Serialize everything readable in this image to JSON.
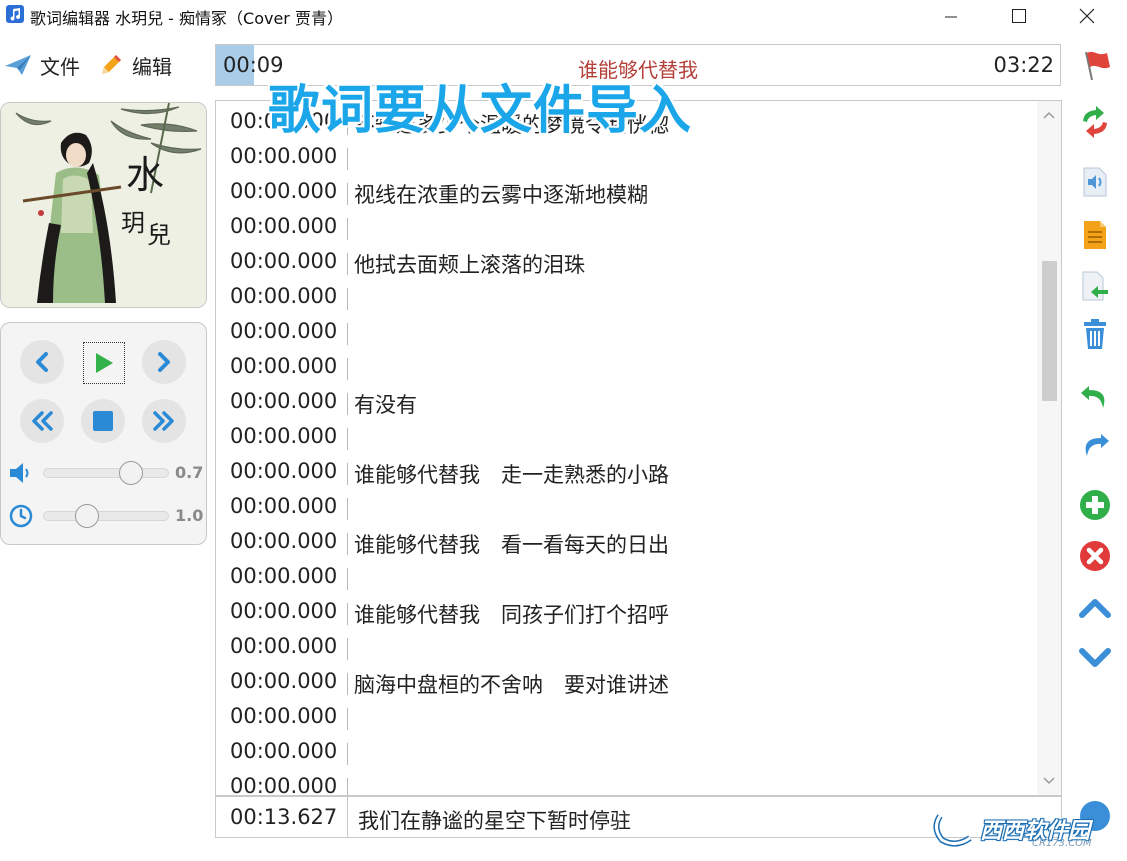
{
  "window": {
    "title": "歌词编辑器 水玥兒 - 痴情冢（Cover 贾青）",
    "minimize_icon": "minimize-icon",
    "maximize_icon": "maximize-icon",
    "close_icon": "close-icon"
  },
  "menu": {
    "file_label": "文件",
    "edit_label": "编辑"
  },
  "progress": {
    "current_time": "00:09",
    "song_title": "谁能够代替我",
    "total_time": "03:22",
    "fraction": 0.045
  },
  "overlay_caption": "歌词要从文件导入",
  "album": {
    "artist_text": "水玥兒"
  },
  "player": {
    "volume_value": "0.7",
    "volume_fraction": 0.7,
    "speed_value": "1.0",
    "speed_fraction": 0.35
  },
  "lyrics": [
    {
      "time": "00:00.000",
      "text": "不知道多少个温暖的梦境令我恍惚"
    },
    {
      "time": "00:00.000",
      "text": ""
    },
    {
      "time": "00:00.000",
      "text": "视线在浓重的云雾中逐渐地模糊"
    },
    {
      "time": "00:00.000",
      "text": ""
    },
    {
      "time": "00:00.000",
      "text": "他拭去面颊上滚落的泪珠"
    },
    {
      "time": "00:00.000",
      "text": ""
    },
    {
      "time": "00:00.000",
      "text": ""
    },
    {
      "time": "00:00.000",
      "text": ""
    },
    {
      "time": "00:00.000",
      "text": "有没有"
    },
    {
      "time": "00:00.000",
      "text": ""
    },
    {
      "time": "00:00.000",
      "text": "谁能够代替我　走一走熟悉的小路"
    },
    {
      "time": "00:00.000",
      "text": ""
    },
    {
      "time": "00:00.000",
      "text": "谁能够代替我　看一看每天的日出"
    },
    {
      "time": "00:00.000",
      "text": ""
    },
    {
      "time": "00:00.000",
      "text": "谁能够代替我　同孩子们打个招呼"
    },
    {
      "time": "00:00.000",
      "text": ""
    },
    {
      "time": "00:00.000",
      "text": "脑海中盘桓的不舍呐　要对谁讲述"
    },
    {
      "time": "00:00.000",
      "text": ""
    },
    {
      "time": "00:00.000",
      "text": ""
    },
    {
      "time": "00:00.000",
      "text": ""
    }
  ],
  "edit": {
    "time": "00:13.627",
    "lyric": "我们在静谧的星空下暂时停驻"
  },
  "toolbar_icons": [
    "refresh-icon",
    "audio-file-icon",
    "document-icon",
    "import-file-icon",
    "trash-icon",
    "undo-icon",
    "redo-icon",
    "add-icon",
    "delete-icon",
    "move-up-icon",
    "move-down-icon"
  ],
  "watermark": {
    "text": "西西软件园",
    "sub": "CR173.COM"
  },
  "colors": {
    "accent_blue": "#1aa6e8",
    "title_red": "#b5403a",
    "progress_fill": "#a9cce8",
    "green": "#22a33a",
    "red": "#e03a3a",
    "orange": "#f3a21a"
  }
}
